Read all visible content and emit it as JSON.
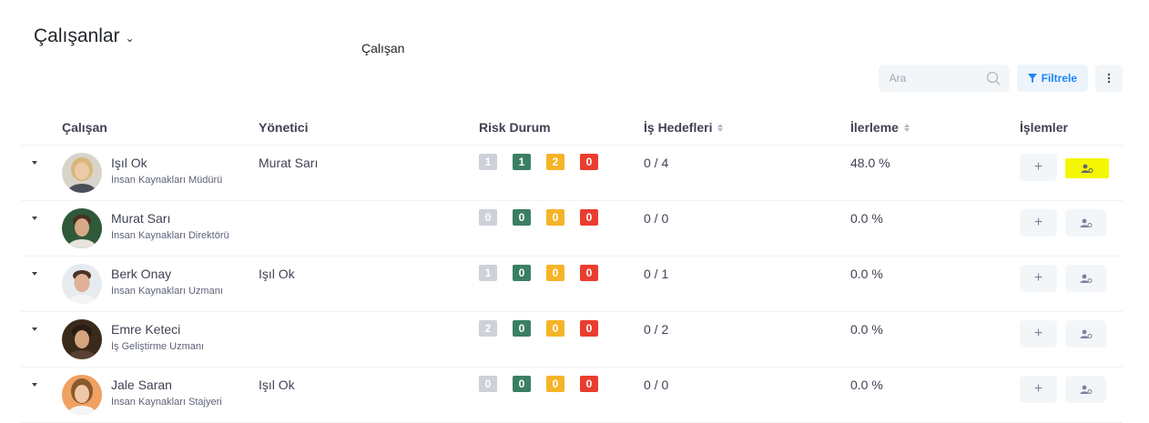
{
  "page": {
    "title": "Çalışanlar",
    "subtitle": "Çalışan"
  },
  "toolbar": {
    "search_placeholder": "Ara",
    "filter_label": "Filtrele"
  },
  "columns": {
    "employee": "Çalışan",
    "manager": "Yönetici",
    "risk": "Risk Durum",
    "goals": "İş Hedefleri",
    "progress": "İlerleme",
    "actions": "İşlemler"
  },
  "risk_colors": [
    "#cdd1d9",
    "#3b7f63",
    "#f5b427",
    "#ea3d2f"
  ],
  "rows": [
    {
      "name": "Işıl Ok",
      "title": "İnsan Kaynakları Müdürü",
      "manager": "Murat Sarı",
      "risk": [
        "1",
        "1",
        "2",
        "0"
      ],
      "goals": "0 / 4",
      "progress": "48.0 %"
    },
    {
      "name": "Murat Sarı",
      "title": "İnsan Kaynakları Direktörü",
      "manager": "",
      "risk": [
        "0",
        "0",
        "0",
        "0"
      ],
      "goals": "0 / 0",
      "progress": "0.0 %"
    },
    {
      "name": "Berk Onay",
      "title": "İnsan Kaynakları Uzmanı",
      "manager": "Işıl Ok",
      "risk": [
        "1",
        "0",
        "0",
        "0"
      ],
      "goals": "0 / 1",
      "progress": "0.0 %"
    },
    {
      "name": "Emre Keteci",
      "title": "İş Geliştirme Uzmanı",
      "manager": "",
      "risk": [
        "2",
        "0",
        "0",
        "0"
      ],
      "goals": "0 / 2",
      "progress": "0.0 %"
    },
    {
      "name": "Jale Saran",
      "title": "İnsan Kaynakları Stajyeri",
      "manager": "Işıl Ok",
      "risk": [
        "0",
        "0",
        "0",
        "0"
      ],
      "goals": "0 / 0",
      "progress": "0.0 %"
    }
  ]
}
